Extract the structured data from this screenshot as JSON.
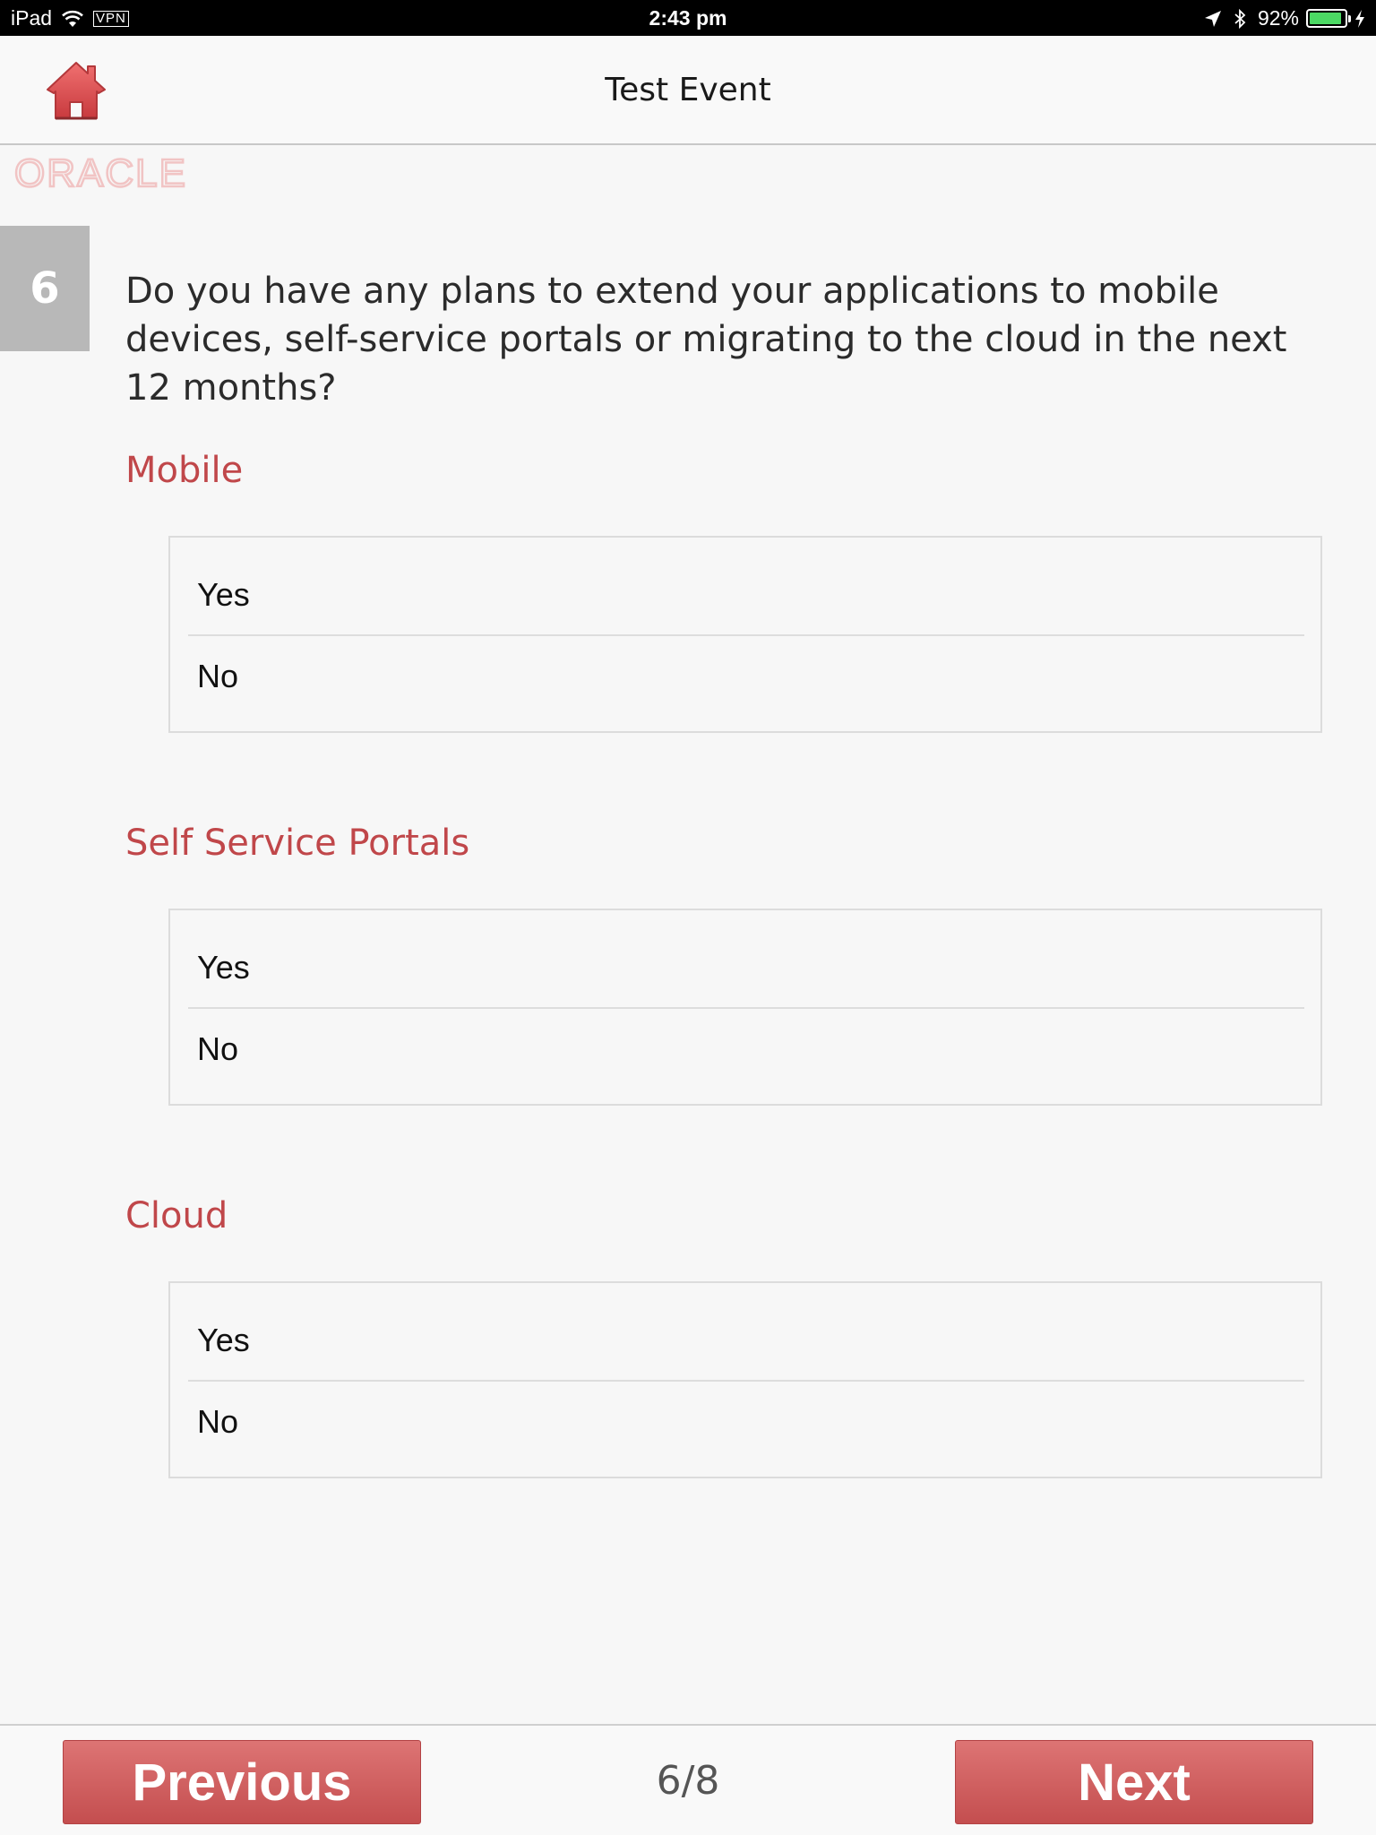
{
  "status_bar": {
    "device": "iPad",
    "vpn": "VPN",
    "time": "2:43 pm",
    "battery_percent": "92%",
    "battery_level": 0.92
  },
  "nav": {
    "title": "Test Event",
    "home_icon": "home-icon"
  },
  "logo": {
    "text": "ORACLE"
  },
  "question": {
    "number": "6",
    "text": "Do you have any plans to extend your applications to mobile devices, self-service portals or migrating to the cloud in the next 12 months?"
  },
  "sections": [
    {
      "title": "Mobile",
      "options": [
        "Yes",
        "No"
      ]
    },
    {
      "title": "Self Service Portals",
      "options": [
        "Yes",
        "No"
      ]
    },
    {
      "title": "Cloud",
      "options": [
        "Yes",
        "No"
      ]
    }
  ],
  "footer": {
    "previous_label": "Previous",
    "next_label": "Next",
    "page": "6/8"
  },
  "colors": {
    "accent": "#c0474a",
    "button": "#d05e5f",
    "badge": "#b8b8b8"
  }
}
